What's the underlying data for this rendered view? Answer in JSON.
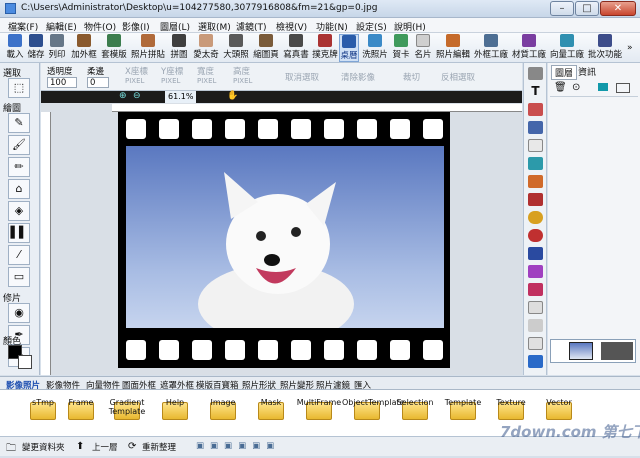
{
  "window": {
    "title": "C:\\Users\\Administrator\\Desktop\\u=104277580,3077916808&fm=21&gp=0.jpg",
    "min": "–",
    "max": "□",
    "close": "✕"
  },
  "menu": [
    "檔案(F)",
    "編輯(E)",
    "物件(O)",
    "影像(I)",
    "圖層(L)",
    "選取(M)",
    "濾鏡(T)",
    "檢視(V)",
    "功能(N)",
    "設定(S)",
    "說明(H)"
  ],
  "toolbar": [
    "載入",
    "儲存",
    "列印",
    "加外框",
    "套模版",
    "照片拼貼",
    "拼圖",
    "愛太奇",
    "大頭照",
    "縮圖頁",
    "寫真書",
    "撲克牌",
    "桌曆",
    "洗照片",
    "賀卡",
    "名片",
    "照片編輯",
    "外框工廠",
    "材質工廠",
    "向量工廠",
    "批次功能"
  ],
  "left": {
    "select": "選取",
    "draw": "繪圖",
    "retouch": "修片",
    "color": "顏色"
  },
  "props": {
    "opacity_label": "透明度",
    "opacity_value": "100",
    "edge_label": "柔邊",
    "edge_value": "0",
    "x_label": "X座標",
    "y_label": "Y座標",
    "w_label": "寬度",
    "h_label": "高度",
    "unit": "PIXEL",
    "cancel": "取消選取",
    "clear": "清除影像",
    "crop": "裁切",
    "invert": "反相選取"
  },
  "zoom": "61.1%",
  "right_tabs": [
    "圖層",
    "資訊"
  ],
  "bottom_tabs": [
    "影像照片",
    "影像物件",
    "向量物件",
    "圖面外框",
    "遮罩外框",
    "模版百寶箱",
    "照片形狀",
    "照片變形",
    "照片濾鏡",
    "匯入"
  ],
  "folders": [
    "sTmp",
    "Frame",
    "Gradient Template",
    "Help",
    "Image",
    "Mask",
    "MultiFrame",
    "ObjectTemplate",
    "Selection",
    "Template",
    "Texture",
    "Vector"
  ],
  "status": {
    "change_folder": "變更資料夾",
    "up": "上一層",
    "refresh": "重新整理"
  },
  "watermark": "7down.com 第七下載"
}
